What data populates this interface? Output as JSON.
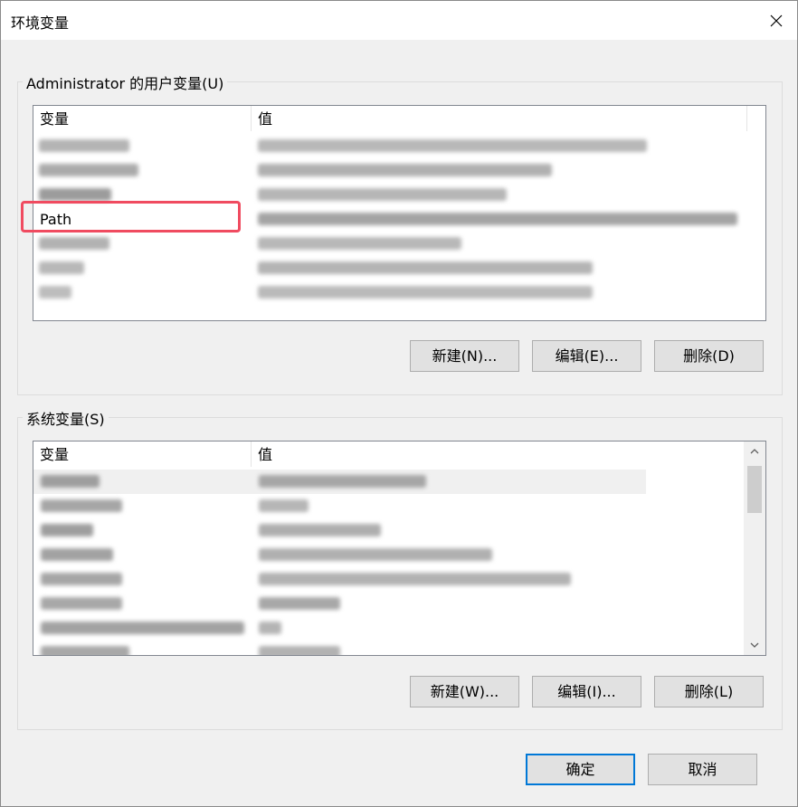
{
  "window": {
    "title": "环境变量"
  },
  "user_vars": {
    "group_label": "Administrator 的用户变量(U)",
    "col_name": "变量",
    "col_value": "值",
    "rows": [
      {
        "name": ""
      },
      {
        "name": ""
      },
      {
        "name": ""
      },
      {
        "name": "Path"
      },
      {
        "name": ""
      },
      {
        "name": ""
      },
      {
        "name": ""
      }
    ],
    "new_label": "新建(N)...",
    "edit_label": "编辑(E)...",
    "delete_label": "删除(D)"
  },
  "system_vars": {
    "group_label": "系统变量(S)",
    "col_name": "变量",
    "col_value": "值",
    "new_label": "新建(W)...",
    "edit_label": "编辑(I)...",
    "delete_label": "删除(L)"
  },
  "footer": {
    "ok_label": "确定",
    "cancel_label": "取消"
  },
  "colors": {
    "highlight": "#f04b60",
    "primary_border": "#0078d7"
  }
}
